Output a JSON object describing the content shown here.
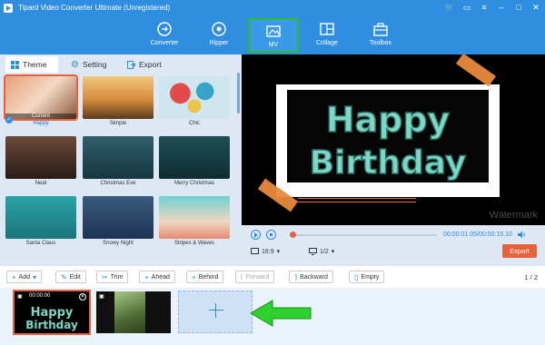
{
  "app": {
    "title": "Tipard Video Converter Ultimate (Unregistered)"
  },
  "nav": [
    {
      "label": "Converter",
      "icon": "converter-icon"
    },
    {
      "label": "Ripper",
      "icon": "ripper-icon"
    },
    {
      "label": "MV",
      "icon": "mv-icon",
      "active": true
    },
    {
      "label": "Collage",
      "icon": "collage-icon"
    },
    {
      "label": "Toolbox",
      "icon": "toolbox-icon"
    }
  ],
  "tabs": [
    {
      "label": "Theme",
      "active": true
    },
    {
      "label": "Setting"
    },
    {
      "label": "Export"
    }
  ],
  "themes": [
    {
      "label": "Happy",
      "selected": true,
      "badge": "Current"
    },
    {
      "label": "Simple"
    },
    {
      "label": "Chic"
    },
    {
      "label": "Neat"
    },
    {
      "label": "Christmas Eve"
    },
    {
      "label": "Merry Christmas"
    },
    {
      "label": "Santa Claus"
    },
    {
      "label": "Snowy Night"
    },
    {
      "label": "Stripes & Waves"
    }
  ],
  "preview": {
    "line1": "Happy",
    "line2": "Birthday",
    "watermark": "Watermark"
  },
  "player": {
    "current_time": "00:00:01.05",
    "total_time": "00:00:15.10",
    "progress": 0.0,
    "aspect": "16:9",
    "page": "1/2",
    "export_label": "Export"
  },
  "edit": {
    "add": "Add",
    "edit": "Edit",
    "trim": "Trim",
    "ahead": "Ahead",
    "behind": "Behind",
    "forward": "Forward",
    "backward": "Backward",
    "empty": "Empty",
    "pager": "1 / 2"
  },
  "clips": [
    {
      "time": "00:00:00",
      "title1": "Happy",
      "title2": "Birthday"
    },
    {
      "time": ""
    }
  ],
  "colors": {
    "brand": "#2f8ee0",
    "accent": "#e8613a",
    "active_outline": "#2dbd2d"
  }
}
